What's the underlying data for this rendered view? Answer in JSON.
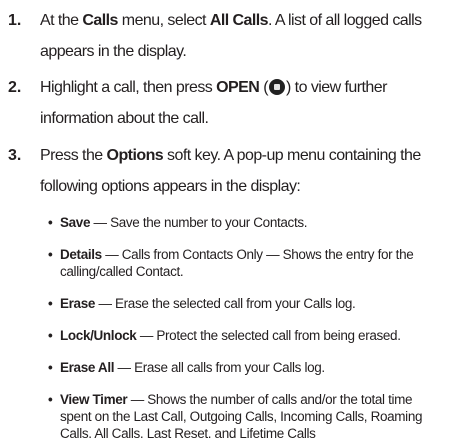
{
  "steps": [
    {
      "number": "1.",
      "line1": {
        "pre": "At the ",
        "b1": "Calls",
        "mid": " menu, select ",
        "b2": "All Calls",
        "post": ". A list of all logged calls"
      },
      "line2": "appears in the display."
    },
    {
      "number": "2.",
      "line1": {
        "pre": "Highlight a call, then press ",
        "b1": "OPEN",
        "open_paren": " (",
        "close_paren": ") to view further"
      },
      "line2": "information about the call."
    },
    {
      "number": "3.",
      "line1": {
        "pre": "Press the ",
        "b1": "Options",
        "post": " soft key. A pop-up menu containing the"
      },
      "line2": "following options appears in the display:"
    }
  ],
  "options": [
    {
      "term": "Save",
      "desc": " — Save the number to your Contacts."
    },
    {
      "term": "Details",
      "desc": " — Calls from Contacts Only — Shows the entry for the",
      "desc2": "calling/called Contact."
    },
    {
      "term": "Erase",
      "desc": " — Erase the selected call from your Calls log."
    },
    {
      "term": "Lock/Unlock",
      "desc": " — Protect the selected call from being erased."
    },
    {
      "term": "Erase All",
      "desc": " — Erase all calls from your Calls log."
    },
    {
      "term": "View Timer",
      "desc": " — Shows the number of calls and/or the total time",
      "desc2": "spent on the Last Call, Outgoing Calls, Incoming Calls, Roaming",
      "desc3": "Calls. All Calls. Last Reset. and Lifetime Calls"
    }
  ],
  "bullet_glyph": "•",
  "icons": {
    "open_key": "open-key-icon"
  }
}
